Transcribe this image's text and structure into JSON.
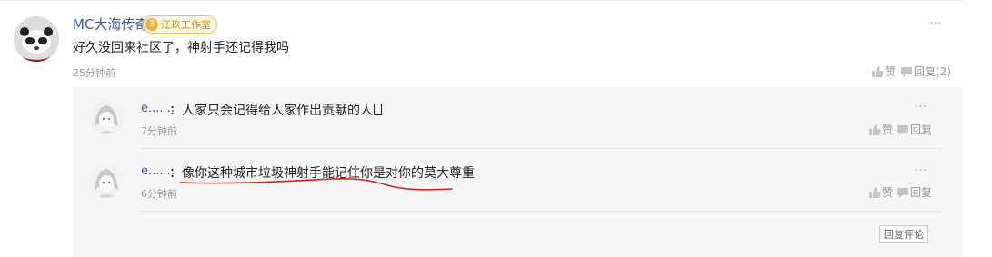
{
  "comment": {
    "username": "MC大海传奇",
    "badge_level": "3",
    "badge_text": "江玖工作室",
    "text": "好久没回来社区了，神射手还记得我吗",
    "time": "25分钟前",
    "like_label": "赞",
    "reply_label": "回复(2)",
    "more": "···"
  },
  "replies": [
    {
      "username": "e.......",
      "colon": "：",
      "text": "人家只会记得给人家作出贡献的人",
      "time": "7分钟前",
      "like_label": "赞",
      "reply_label": "回复",
      "more": "···"
    },
    {
      "username": "e.......",
      "colon": "：",
      "text": "像你这种城市垃圾神射手能记住你是对你的莫大尊重",
      "time": "6分钟前",
      "like_label": "赞",
      "reply_label": "回复",
      "more": "···"
    }
  ],
  "reply_comment_button": "回复评论",
  "colors": {
    "name": "#3d5a99",
    "annotation": "#d42020",
    "badge": "#f0b43c"
  }
}
